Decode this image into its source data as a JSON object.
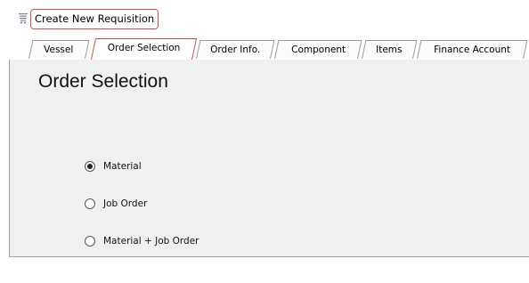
{
  "window": {
    "title": "Create New Requisition",
    "icon": "cart-icon"
  },
  "tabs": [
    {
      "label": "Vessel",
      "active": false
    },
    {
      "label": "Order Selection",
      "active": true
    },
    {
      "label": "Order Info.",
      "active": false
    },
    {
      "label": "Component",
      "active": false
    },
    {
      "label": "Items",
      "active": false
    },
    {
      "label": "Finance Account",
      "active": false
    }
  ],
  "panel": {
    "title": "Order Selection",
    "options": [
      {
        "label": "Material",
        "checked": true
      },
      {
        "label": "Job Order",
        "checked": false
      },
      {
        "label": "Material + Job Order",
        "checked": false
      }
    ]
  },
  "colors": {
    "highlight_border": "#e0464e",
    "panel_background": "#f0f0f0"
  }
}
